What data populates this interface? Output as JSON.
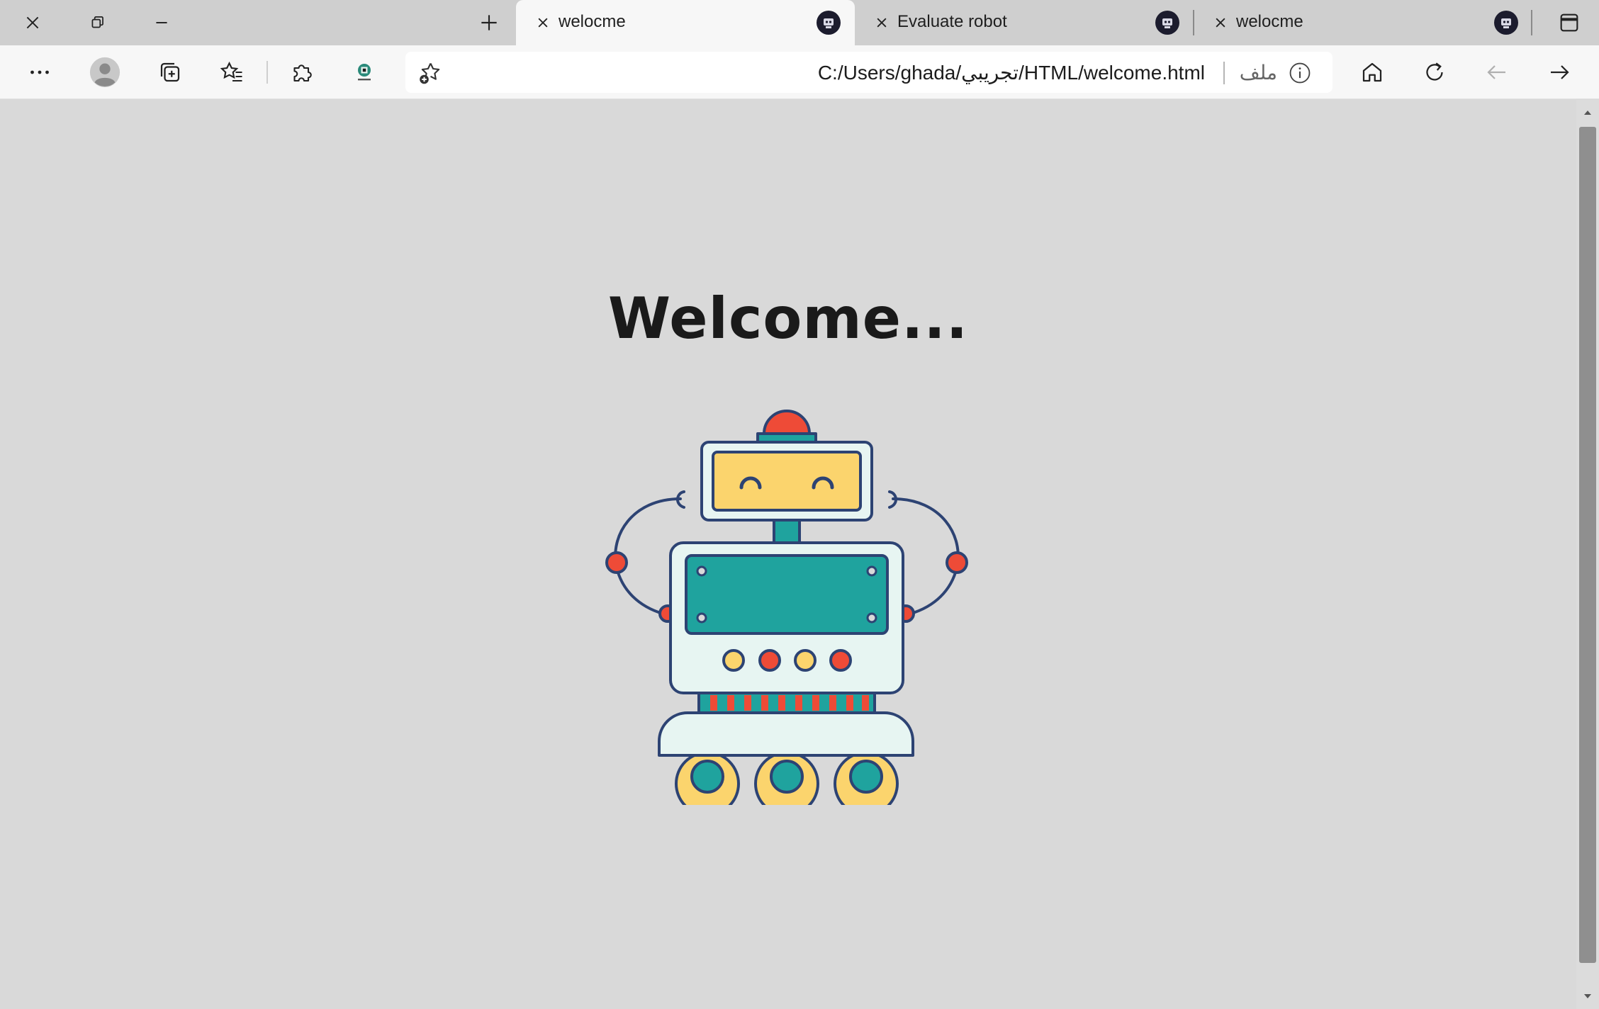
{
  "window": {
    "close_icon": "close-icon",
    "restore_icon": "restore-icon",
    "minimize_icon": "minimize-icon",
    "tab_actions_icon": "tab-actions-icon"
  },
  "tabs": [
    {
      "title": "welocme",
      "active": true
    },
    {
      "title": "Evaluate robot",
      "active": false
    },
    {
      "title": "welocme",
      "active": false
    }
  ],
  "toolbar": {
    "url": "C:/Users/ghada/تجريبي/HTML/welcome.html",
    "scheme_label": "ملف"
  },
  "page": {
    "heading": "Welcome..."
  },
  "colors": {
    "outline": "#2d4373",
    "teal": "#1fa39e",
    "yellow": "#fbd46d",
    "red": "#ee4b37",
    "body": "#e7f5f2"
  }
}
